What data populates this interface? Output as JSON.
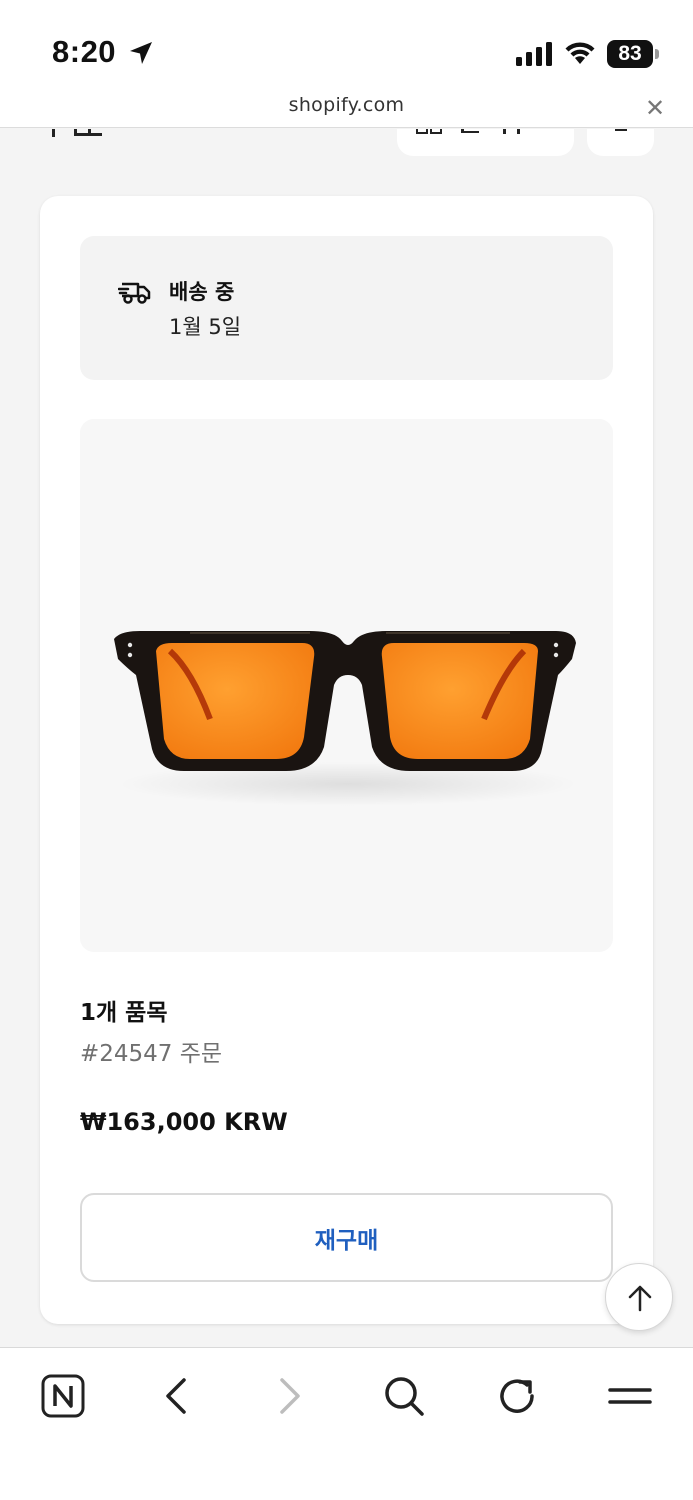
{
  "status_bar": {
    "time": "8:20",
    "battery_percent": "83",
    "icons": [
      "location-arrow-icon",
      "cellular-signal-icon",
      "wifi-icon",
      "battery-icon"
    ]
  },
  "browser": {
    "url": "shopify.com",
    "close_icon": "close-icon",
    "toolbar_icons": [
      "naver-home-icon",
      "back-icon",
      "forward-icon",
      "search-icon",
      "reload-icon",
      "menu-icon"
    ]
  },
  "order": {
    "shipping_status": "배송 중",
    "shipping_date": "1월 5일",
    "shipping_icon": "delivery-truck-icon",
    "product_image": "orange-lens-sunglasses",
    "item_count": "1개 품목",
    "order_number": "#24547 주문",
    "total": "₩163,000 KRW",
    "reorder_label": "재구매"
  },
  "colors": {
    "accent_link": "#1f5fbf",
    "page_background": "#f4f4f4",
    "card_background": "#ffffff",
    "panel_background": "#f3f3f3",
    "lens_orange": "#ff8a1e"
  }
}
